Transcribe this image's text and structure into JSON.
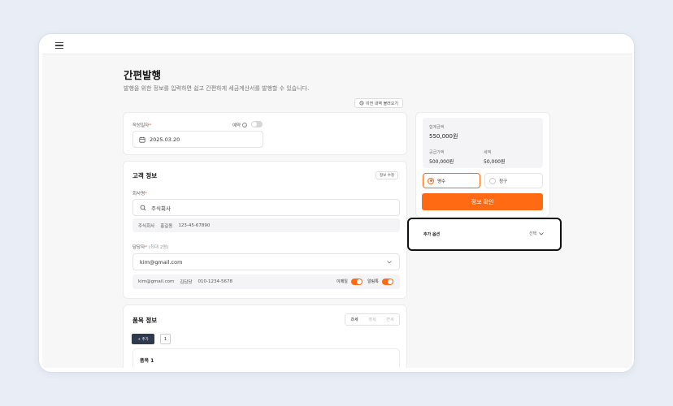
{
  "page": {
    "title": "간편발행",
    "subtitle": "발행을 위한 정보를 입력하면 쉽고 간편하게 세금계산서를 발행할 수 있습니다.",
    "load_previous": "이전 내역 불러오기"
  },
  "date_section": {
    "label": "작성일자",
    "required_mark": "*",
    "reserve_label": "예약",
    "reserve_on": false,
    "date_value": "2025.03.20"
  },
  "customer": {
    "section_title": "고객 정보",
    "edit_button": "정보 수정",
    "company_label": "회사명",
    "required_mark": "*",
    "company_value": "주식회사",
    "company_name": "주식회사",
    "representative": "홍길동",
    "business_number": "123-45-67890",
    "manager_label": "담당자",
    "manager_hint": "(최대 2명)",
    "manager_email_value": "kim@gmail.com",
    "contact_email": "kim@gmail.com",
    "contact_name": "김담당",
    "contact_phone": "010-1234-5678",
    "email_toggle_label": "이메일",
    "email_toggle_on": true,
    "alimtalk_toggle_label": "알림톡",
    "alimtalk_toggle_on": true
  },
  "items": {
    "section_title": "품목 정보",
    "tabs": [
      {
        "label": "과세",
        "active": true
      },
      {
        "label": "영세",
        "active": false
      },
      {
        "label": "면세",
        "active": false
      }
    ],
    "add_button": "+ 추가",
    "count": "1",
    "item_title": "품목 1"
  },
  "summary": {
    "total_label": "합계금액",
    "total_value": "550,000원",
    "supply_label": "공급가액",
    "supply_value": "500,000원",
    "tax_label": "세액",
    "tax_value": "50,000원",
    "receipt_label": "영수",
    "receipt_selected": true,
    "claim_label": "청구",
    "confirm_button": "정보 확인"
  },
  "additional_options": {
    "label": "추가 옵션",
    "select_label": "선택"
  },
  "colors": {
    "accent": "#ff6a13",
    "navy_button": "#2f3a4f",
    "background": "#e9edf5"
  }
}
